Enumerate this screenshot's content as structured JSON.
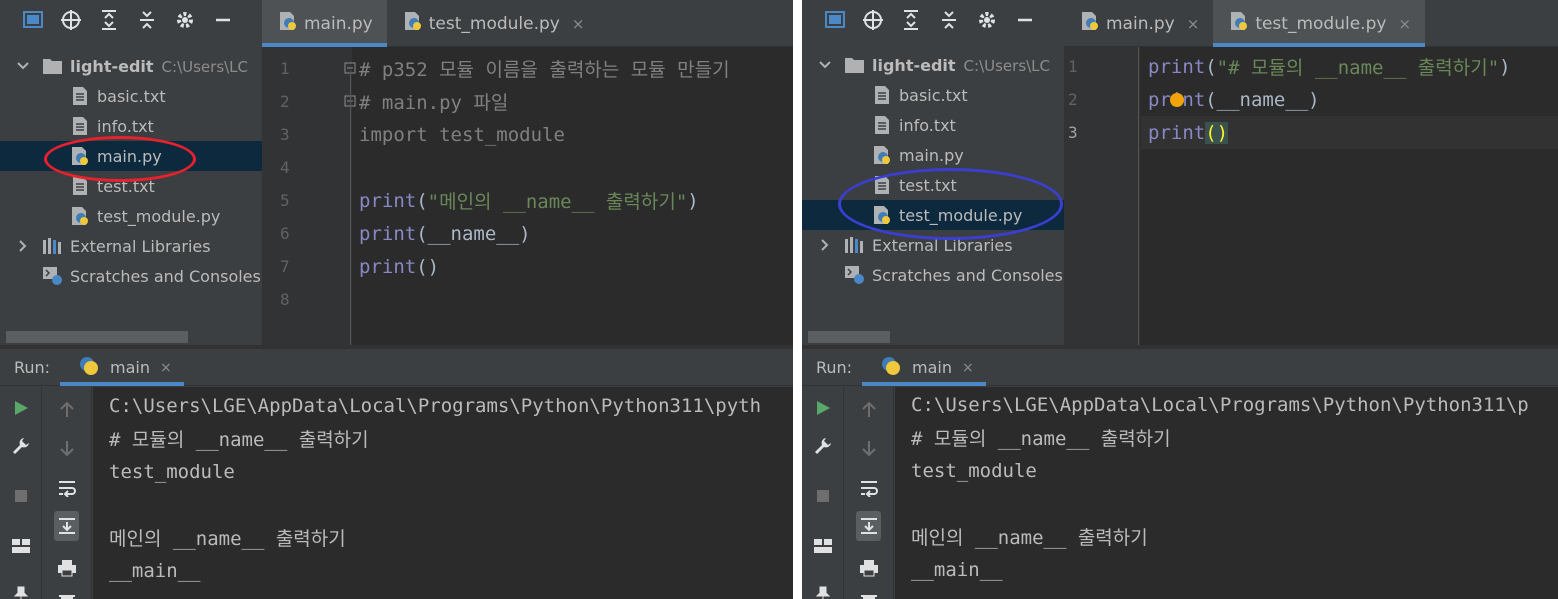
{
  "colors": {
    "accent": "#4a88c7",
    "red_circle": "#e8212e",
    "blue_circle": "#3a3fd1",
    "background": "#2b2b2b",
    "panel": "#3c3f41"
  },
  "left": {
    "project": {
      "root_name": "light-edit",
      "root_path": "C:\\Users\\LC",
      "files": [
        "basic.txt",
        "info.txt",
        "main.py",
        "test.txt",
        "test_module.py"
      ],
      "external": "External Libraries",
      "scratches": "Scratches and Consoles"
    },
    "tabs": [
      {
        "label": "main.py",
        "close": "×"
      },
      {
        "label": "test_module.py",
        "close": "×"
      }
    ],
    "line_numbers": [
      "1",
      "2",
      "3",
      "4",
      "5",
      "6",
      "7",
      "8"
    ],
    "code": {
      "l1": "# p352 모듈 이름을 출력하는 모듈 만들기",
      "l2": "# main.py 파일",
      "l3": "import test_module",
      "l5_fn": "print",
      "l5_open": "(",
      "l5_str": "\"메인의 __name__ 출력하기\"",
      "l5_close": ")",
      "l6_fn": "print",
      "l6_arg": "(__name__)",
      "l7_fn": "print",
      "l7_arg": "()"
    },
    "run": {
      "label": "Run:",
      "tab": "main",
      "close": "×",
      "output": [
        "C:\\Users\\LGE\\AppData\\Local\\Programs\\Python\\Python311\\pyth",
        "# 모듈의 __name__ 출력하기",
        "test_module",
        "",
        "메인의 __name__ 출력하기",
        "__main__"
      ]
    }
  },
  "right": {
    "project": {
      "root_name": "light-edit",
      "root_path": "C:\\Users\\LC",
      "files": [
        "basic.txt",
        "info.txt",
        "main.py",
        "test.txt",
        "test_module.py"
      ],
      "external": "External Libraries",
      "scratches": "Scratches and Consoles"
    },
    "tabs": [
      {
        "label": "main.py",
        "close": "×"
      },
      {
        "label": "test_module.py",
        "close": "×"
      }
    ],
    "line_numbers": [
      "1",
      "2",
      "3"
    ],
    "code": {
      "l1_fn": "print",
      "l1_open": "(",
      "l1_str": "\"# 모듈의 __name__ 출력하기\"",
      "l1_close": ")",
      "l2_fn": "print",
      "l2_arg": "(__name__)",
      "l3_fn": "print",
      "l3_arg": "()"
    },
    "run": {
      "label": "Run:",
      "tab": "main",
      "close": "×",
      "output": [
        "C:\\Users\\LGE\\AppData\\Local\\Programs\\Python\\Python311\\p",
        "# 모듈의 __name__ 출력하기",
        "test_module",
        "",
        "메인의 __name__ 출력하기",
        "__main__"
      ]
    }
  }
}
